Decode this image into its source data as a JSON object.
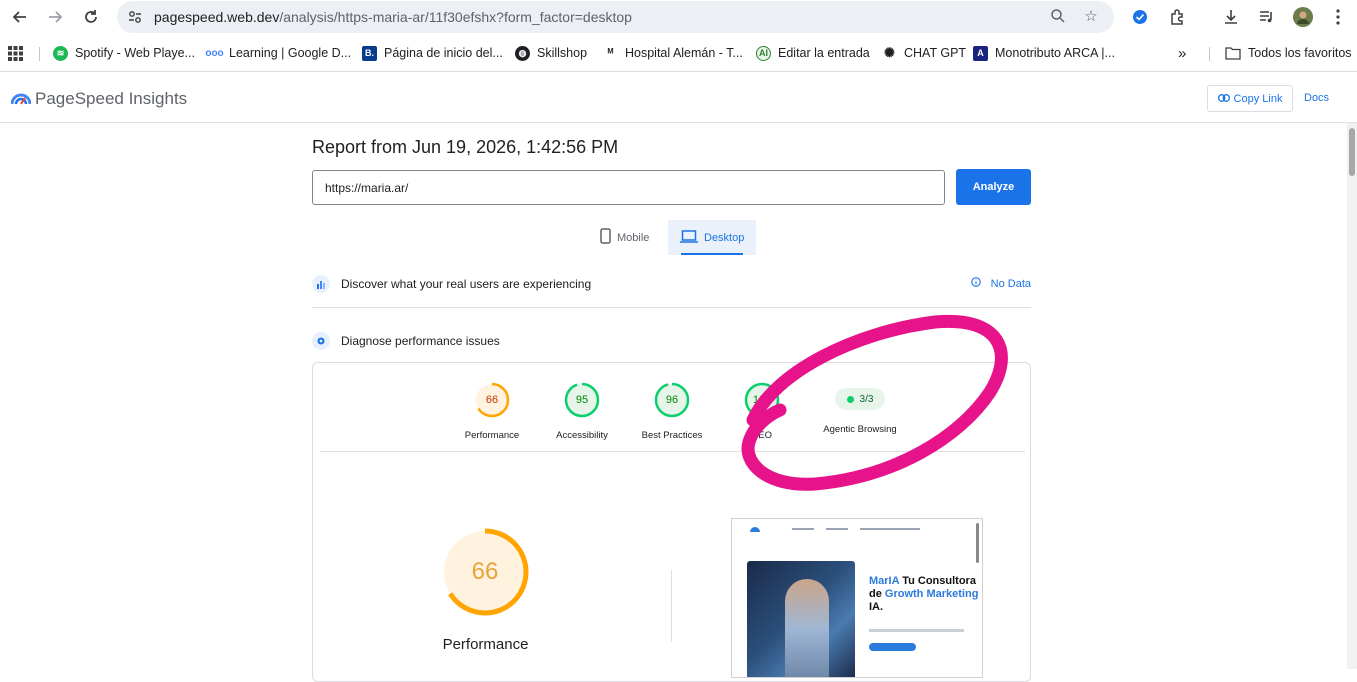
{
  "browser": {
    "url_host": "pagespeed.web.dev",
    "url_path": "/analysis/https-maria-ar/11f30efshx?form_factor=desktop"
  },
  "bookmarks": [
    {
      "label": "Spotify - Web Playe...",
      "color": "#1db954"
    },
    {
      "label": "Learning | Google D...",
      "color": "#4285f4"
    },
    {
      "label": "Página de inicio del...",
      "color": "#0a3a8a"
    },
    {
      "label": "Skillshop",
      "color": "#202124"
    },
    {
      "label": "Hospital Alemán - T...",
      "color": "#202124"
    },
    {
      "label": "Editar la entrada",
      "color": "#2e7d32"
    },
    {
      "label": "CHAT GPT",
      "color": "#202124"
    },
    {
      "label": "Monotributo ARCA |...",
      "color": "#1a237e"
    }
  ],
  "bookmarks_more": "»",
  "bookmarks_folder": "Todos los favoritos",
  "header": {
    "title": "PageSpeed Insights",
    "copy_link": "Copy Link",
    "docs": "Docs"
  },
  "report": {
    "title": "Report from Jun 19, 2026, 1:42:56 PM",
    "url_value": "https://maria.ar/",
    "analyze": "Analyze"
  },
  "tabs": {
    "mobile": "Mobile",
    "desktop": "Desktop"
  },
  "crux": {
    "label": "Discover what your real users are experiencing",
    "no_data": "No Data"
  },
  "diagnose": {
    "label": "Diagnose performance issues"
  },
  "scores": [
    {
      "value": "66",
      "label": "Performance",
      "score": 0.66,
      "color": "#ffa400",
      "bg": "#fff3e0",
      "text": "#c33300"
    },
    {
      "value": "95",
      "label": "Accessibility",
      "score": 0.95,
      "color": "#0cce6b",
      "bg": "#e6f4ea",
      "text": "#008800"
    },
    {
      "value": "96",
      "label": "Best Practices",
      "score": 0.96,
      "color": "#0cce6b",
      "bg": "#e6f4ea",
      "text": "#008800"
    },
    {
      "value": "100",
      "label": "SEO",
      "score": 1.0,
      "color": "#0cce6b",
      "bg": "#e6f4ea",
      "text": "#008800"
    }
  ],
  "agentic": {
    "value": "3/3",
    "label": "Agentic Browsing"
  },
  "big_score": {
    "value": "66",
    "label": "Performance",
    "score": 0.66
  },
  "thumbnail": {
    "heading_blue_1": "MarIA",
    "heading_black": " Tu Consultora de ",
    "heading_blue_2": "Growth Marketing",
    "heading_end": " IA."
  },
  "annotation_color": "#e6138a"
}
